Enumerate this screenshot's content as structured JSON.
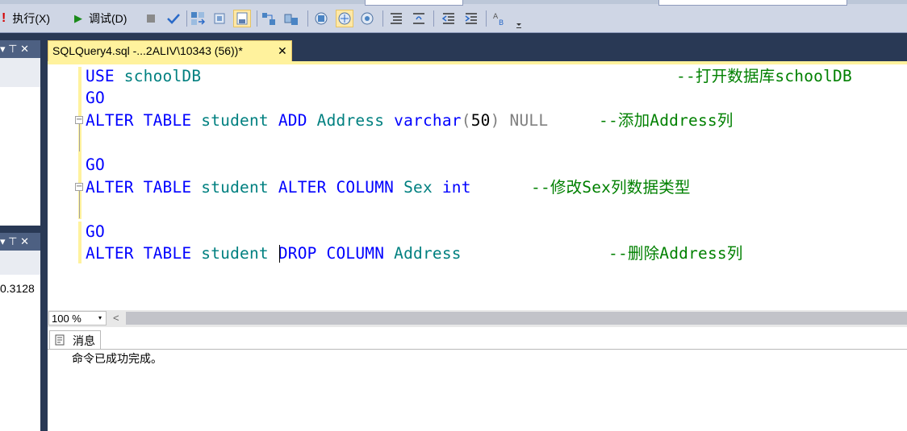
{
  "toolbar": {
    "execute_label": "执行(X)",
    "debug_label": "调试(D)"
  },
  "left_panels": {
    "upper_icons": "▾ ⊤ ✕",
    "lower_icons": "▾ ⊤ ✕",
    "value_text": "0.3128"
  },
  "document_tab": {
    "title": "SQLQuery4.sql -...2ALIV\\10343 (56))*",
    "close_glyph": "✕"
  },
  "editor": {
    "lines": [
      {
        "segments": [
          {
            "t": "USE",
            "c": "kw"
          },
          {
            "t": " "
          },
          {
            "t": "schoolDB",
            "c": "id"
          }
        ],
        "comment": "--打开数据库schoolDB"
      },
      {
        "segments": [
          {
            "t": "GO",
            "c": "kw"
          }
        ],
        "comment": ""
      },
      {
        "segments": [
          {
            "t": "ALTER TABLE",
            "c": "kw"
          },
          {
            "t": " "
          },
          {
            "t": "student",
            "c": "id"
          },
          {
            "t": " "
          },
          {
            "t": "ADD",
            "c": "kw"
          },
          {
            "t": " "
          },
          {
            "t": "Address",
            "c": "id"
          },
          {
            "t": " "
          },
          {
            "t": "varchar",
            "c": "kw"
          },
          {
            "t": "(",
            "c": "gray"
          },
          {
            "t": "50"
          },
          {
            "t": ")",
            "c": "gray"
          },
          {
            "t": " "
          },
          {
            "t": "NULL",
            "c": "gray"
          }
        ],
        "comment": "--添加Address列"
      },
      {
        "segments": [],
        "comment": ""
      },
      {
        "segments": [
          {
            "t": "GO",
            "c": "kw"
          }
        ],
        "comment": ""
      },
      {
        "segments": [
          {
            "t": "ALTER TABLE",
            "c": "kw"
          },
          {
            "t": " "
          },
          {
            "t": "student",
            "c": "id"
          },
          {
            "t": " "
          },
          {
            "t": "ALTER COLUMN",
            "c": "kw"
          },
          {
            "t": " "
          },
          {
            "t": "Sex",
            "c": "id"
          },
          {
            "t": " "
          },
          {
            "t": "int",
            "c": "kw"
          }
        ],
        "comment": "--修改Sex列数据类型"
      },
      {
        "segments": [],
        "comment": ""
      },
      {
        "segments": [
          {
            "t": "GO",
            "c": "kw"
          }
        ],
        "comment": ""
      },
      {
        "segments": [
          {
            "t": "ALTER TABLE",
            "c": "kw"
          },
          {
            "t": " "
          },
          {
            "t": "student",
            "c": "id"
          },
          {
            "t": " "
          },
          {
            "t": "DROP COLUMN",
            "c": "kw"
          },
          {
            "t": " "
          },
          {
            "t": "Address",
            "c": "id"
          }
        ],
        "comment": "--删除Address列"
      }
    ]
  },
  "zoom": {
    "value": "100 %",
    "arrow": "▾",
    "scroll_left": "<"
  },
  "messages": {
    "tab_label": "消息",
    "text": "命令已成功完成。"
  },
  "colors": {
    "keyword": "#0000ff",
    "identifier": "#008080",
    "comment": "#008000",
    "gray": "#808080",
    "tab_active": "#fff29d"
  }
}
